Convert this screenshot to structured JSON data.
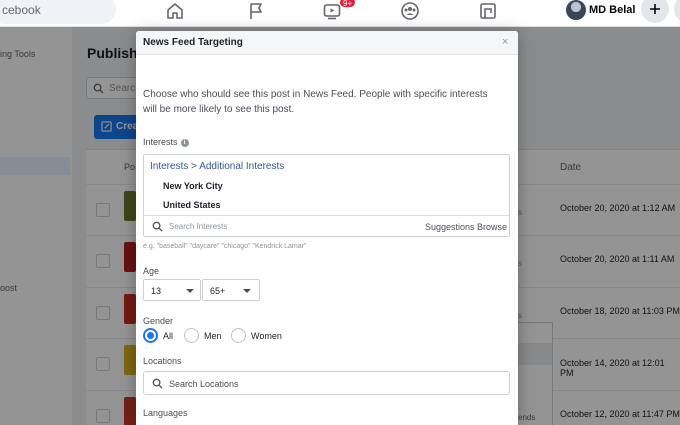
{
  "topbar": {
    "search_text": "cebook",
    "badge": "9+",
    "user_name": "MD Belal"
  },
  "background": {
    "sidebar": {
      "item_1": "ing Tools",
      "item_2": "oost"
    },
    "page_title": "Publishe",
    "search_placeholder": "Searc",
    "create_label": "Crea",
    "col_posts": "Po",
    "col_date": "Date",
    "rows": [
      {
        "date": "October 20, 2020 at 1:12 AM",
        "thumb_color": "#6b7d2b"
      },
      {
        "date": "October 20, 2020 at 1:11 AM",
        "thumb_color": "#b42020"
      },
      {
        "date": "October 18, 2020 at 11:03 PM",
        "thumb_color": "#c4301f"
      },
      {
        "date": "October 14, 2020 at 12:01 PM",
        "thumb_color": "#d9b21f"
      },
      {
        "date": "October 12, 2020 at 11:47 PM",
        "thumb_color": "#c83a2a"
      }
    ],
    "popup_text": "ends"
  },
  "modal": {
    "title": "News Feed Targeting",
    "close": "×",
    "description": "Choose who should see this post in News Feed. People with specific interests will be more likely to see this post.",
    "interests": {
      "label": "Interests",
      "path": "Interests > Additional Interests",
      "items": [
        "New York City",
        "United States"
      ],
      "search_placeholder": "Search Interests",
      "suggestions": "Suggestions",
      "browse": "Browse",
      "example": "e.g. \"baseball\" \"daycare\" \"chicago\" \"Kendrick Lamar\""
    },
    "age": {
      "label": "Age",
      "min": "13",
      "max": "65+"
    },
    "gender": {
      "label": "Gender",
      "options": [
        "All",
        "Men",
        "Women"
      ],
      "selected": "All"
    },
    "locations": {
      "label": "Locations",
      "placeholder": "Search Locations"
    },
    "languages": {
      "label": "Languages"
    }
  },
  "colors": {
    "brand_blue": "#1877f2",
    "link_blue": "#365899",
    "badge_red": "#e41e3f"
  }
}
